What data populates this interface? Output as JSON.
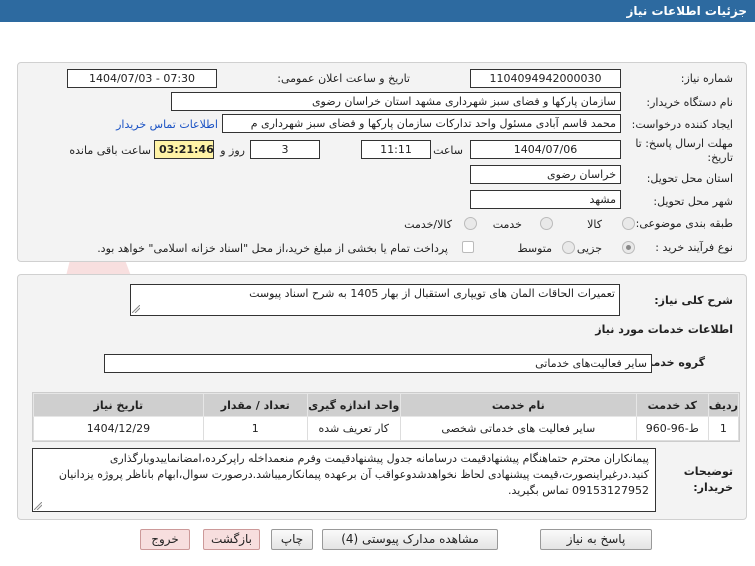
{
  "title": "جزئیات اطلاعات نیاز",
  "fields": {
    "need_number_label": "شماره نیاز:",
    "need_number": "1104094942000030",
    "announce_label": "تاریخ و ساعت اعلان عمومی:",
    "announce_value": "1404/07/03 - 07:30",
    "buyer_org_label": "نام دستگاه خریدار:",
    "buyer_org": "سازمان پارکها و فضای سبز شهرداری مشهد استان خراسان رضوی",
    "creator_label": "ایجاد کننده درخواست:",
    "creator": "محمد قاسم آبادی مسئول واحد تدارکات سازمان پارکها و فضای سبز شهرداری م",
    "contact_link": "اطلاعات تماس خریدار",
    "deadline_label": "مهلت ارسال پاسخ: تا تاریخ:",
    "deadline_date": "1404/07/06",
    "time_label": "ساعت",
    "deadline_time": "11:11",
    "days_value": "3",
    "days_label": "روز و",
    "remaining_time": "03:21:46",
    "remaining_label": "ساعت باقی مانده",
    "province_label": "استان محل تحویل:",
    "province": "خراسان رضوی",
    "city_label": "شهر محل تحویل:",
    "city": "مشهد",
    "category_label": "طبقه بندی موضوعی:",
    "category_options": [
      "کالا",
      "خدمت",
      "کالا/خدمت"
    ],
    "process_label": "نوع فرآیند خرید :",
    "process_options": [
      "جزیی",
      "متوسط"
    ],
    "payment_note": "پرداخت تمام یا بخشی از مبلغ خرید،از محل \"اسناد خزانه اسلامی\" خواهد بود."
  },
  "summary": {
    "label": "شرح کلی نیاز:",
    "text": "تعمیرات الحاقات المان های تویپاری استقبال از بهار 1405 به شرح اسناد پیوست"
  },
  "services_heading": "اطلاعات خدمات مورد نیاز",
  "service_group": {
    "label": "گروه خدمت:",
    "value": "سایر فعالیت‌های خدماتی"
  },
  "table": {
    "headers": [
      "ردیف",
      "کد خدمت",
      "نام خدمت",
      "واحد اندازه گیری",
      "تعداد / مقدار",
      "تاریخ نیاز"
    ],
    "rows": [
      [
        "1",
        "ط-96-960",
        "سایر فعالیت های خدماتی شخصی",
        "کار تعریف شده",
        "1",
        "1404/12/29"
      ]
    ]
  },
  "buyer_notes": {
    "label": "توضیحات خریدار:",
    "text": "پیمانکاران محترم حتماهنگام پیشنهادقیمت درسامانه جدول پیشنهادقیمت وفرم منعمداخله راپرکرده،امضانماییدوبارگذاری کنید.درغیراینصورت،قیمت پیشنهادی لحاظ نخواهدشدوعواقب آن برعهده پیمانکارمیباشد.درصورت سوال،ابهام باناظر پروژه یزدانیان 09153127952 تماس بگیرید."
  },
  "buttons": {
    "reply": "پاسخ به نیاز",
    "attachments": "مشاهده مدارک پیوستی (4)",
    "print": "چاپ",
    "back": "بازگشت",
    "exit": "خروج"
  },
  "colors": {
    "titlebar": "#2d6aa0",
    "link": "#1a52c4",
    "timer_bg": "#fff3a6",
    "pink_button": "#f7dede"
  }
}
